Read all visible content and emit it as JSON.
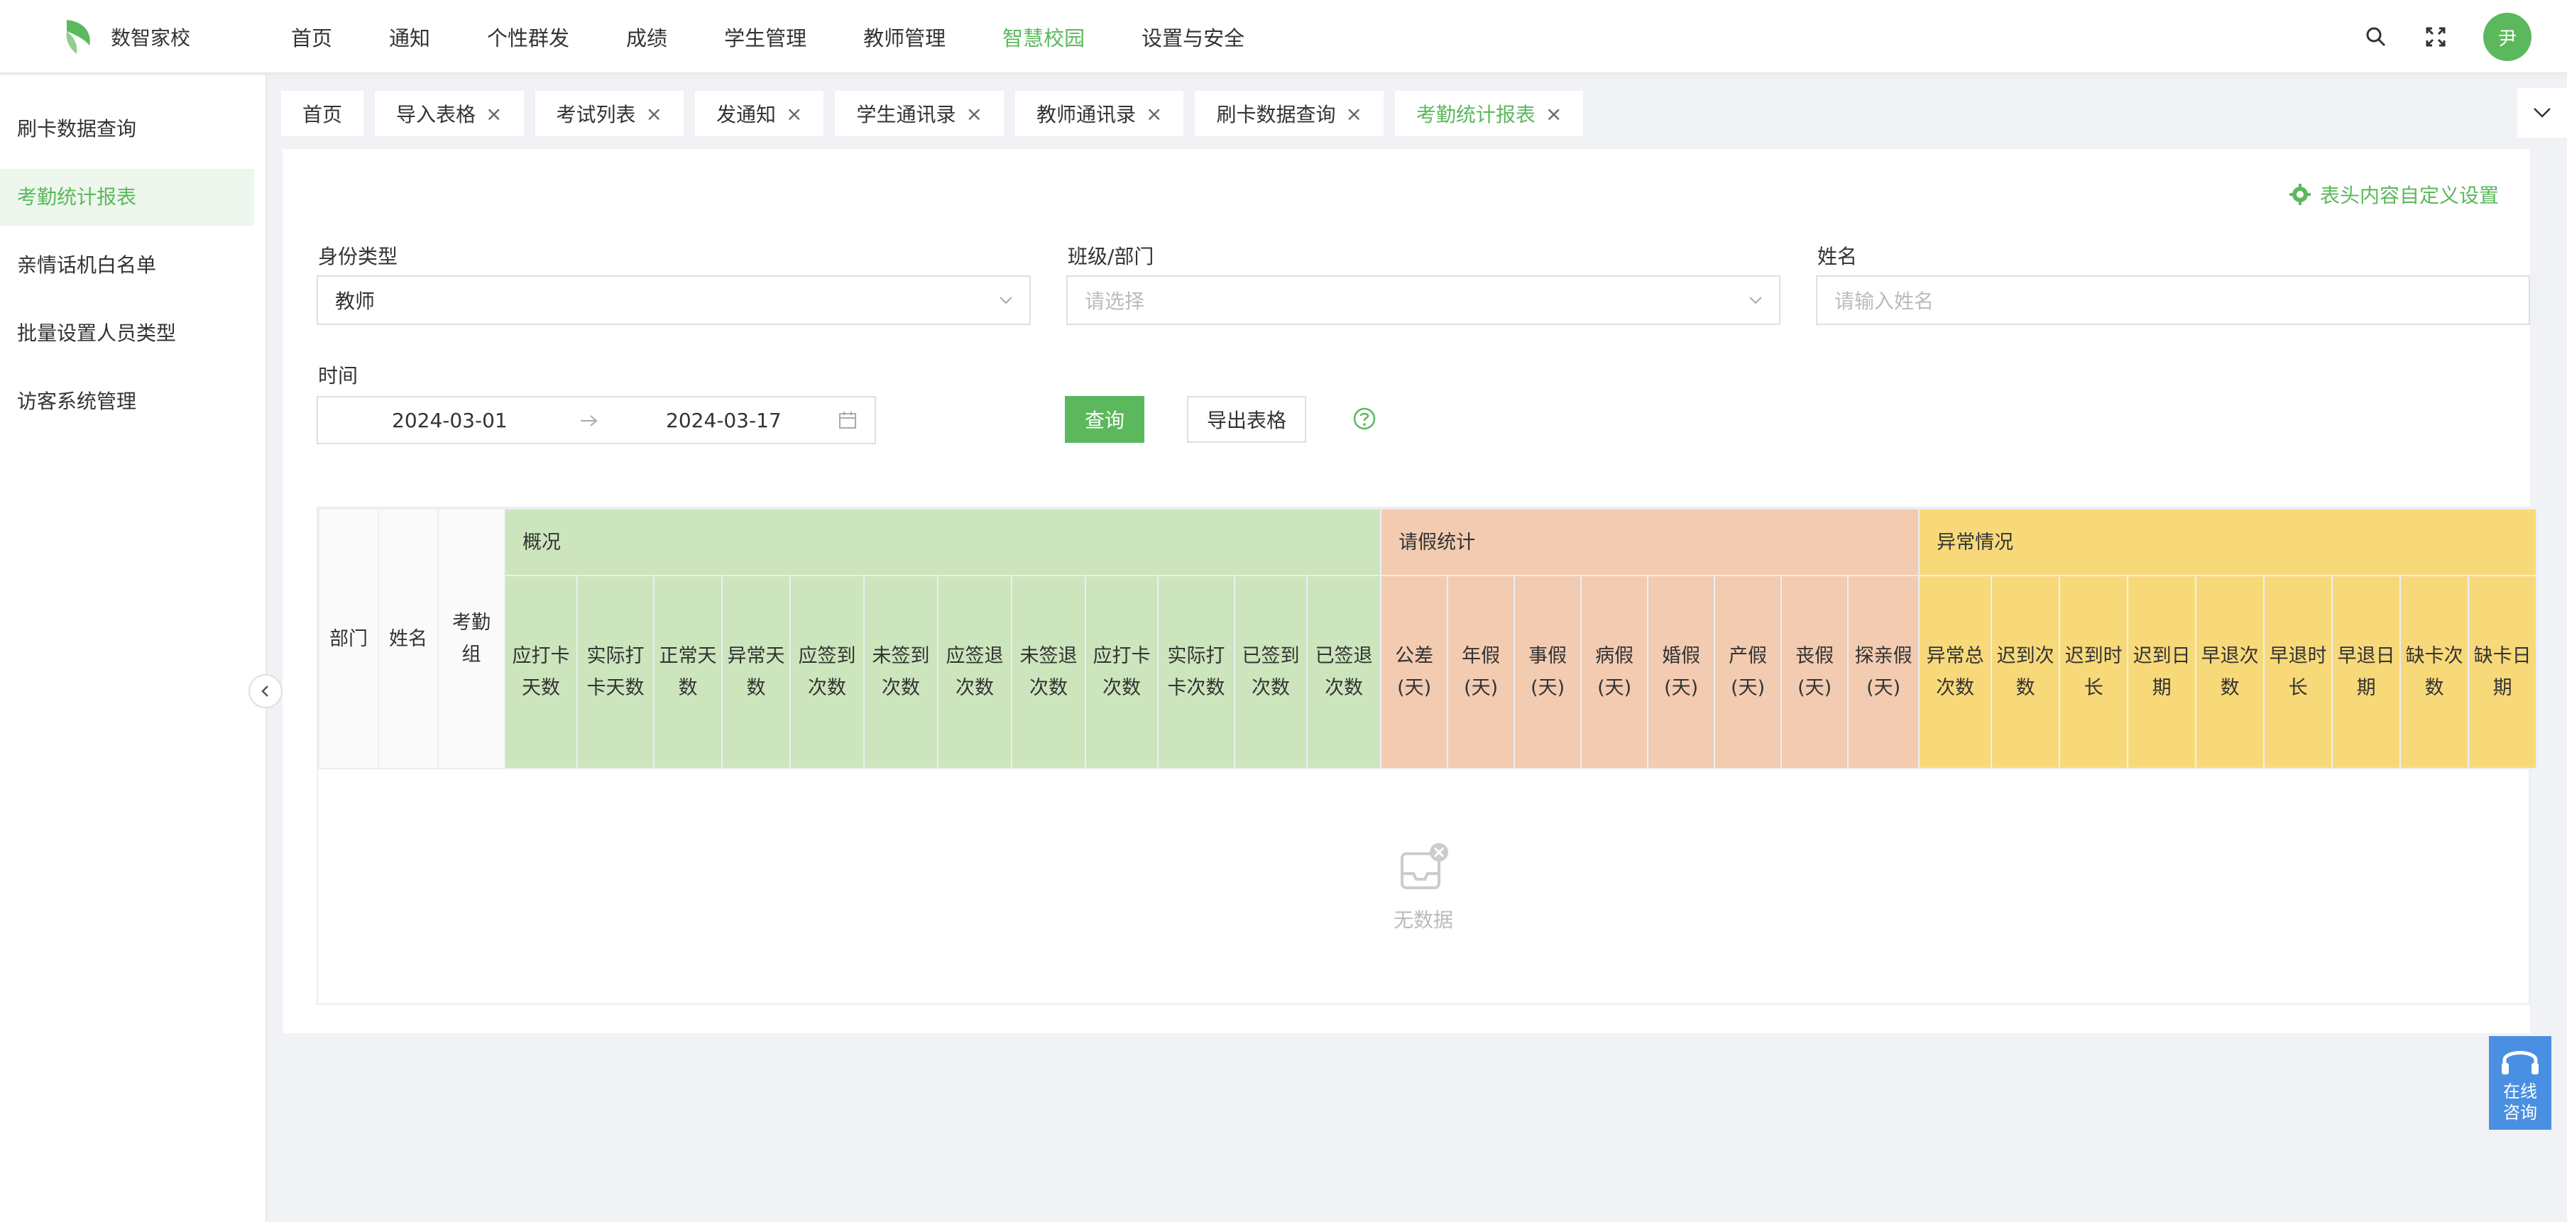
{
  "app": {
    "name": "数智家校",
    "avatar_text": "尹"
  },
  "nav": {
    "items": [
      {
        "label": "首页"
      },
      {
        "label": "通知"
      },
      {
        "label": "个性群发"
      },
      {
        "label": "成绩"
      },
      {
        "label": "学生管理"
      },
      {
        "label": "教师管理"
      },
      {
        "label": "智慧校园"
      },
      {
        "label": "设置与安全"
      }
    ],
    "active": "智慧校园"
  },
  "sidebar": {
    "items": [
      {
        "label": "刷卡数据查询"
      },
      {
        "label": "考勤统计报表"
      },
      {
        "label": "亲情话机白名单"
      },
      {
        "label": "批量设置人员类型"
      },
      {
        "label": "访客系统管理"
      }
    ],
    "active": "考勤统计报表"
  },
  "tabs": [
    {
      "label": "首页"
    },
    {
      "label": "导入表格"
    },
    {
      "label": "考试列表"
    },
    {
      "label": "发通知"
    },
    {
      "label": "学生通讯录"
    },
    {
      "label": "教师通讯录"
    },
    {
      "label": "刷卡数据查询"
    },
    {
      "label": "考勤统计报表"
    }
  ],
  "tab_close": "×",
  "filters": {
    "custom_setting": "表头内容自定义设置",
    "identity": {
      "label": "身份类型",
      "value": "教师"
    },
    "class": {
      "label": "班级/部门",
      "placeholder": "请选择"
    },
    "name": {
      "label": "姓名",
      "placeholder": "请输入姓名"
    },
    "time": {
      "label": "时间",
      "start": "2024-03-01",
      "end": "2024-03-17"
    },
    "query_button": "查询",
    "export_button": "导出表格"
  },
  "table": {
    "base_columns": [
      "部门",
      "姓名",
      "考勤组"
    ],
    "groups": [
      {
        "title": "概况",
        "color": "#cce5bc",
        "columns": [
          "应打卡天数",
          "实际打卡天数",
          "正常天数",
          "异常天数",
          "应签到次数",
          "未签到次数",
          "应签退次数",
          "未签退次数",
          "应打卡次数",
          "实际打卡次数",
          "已签到次数",
          "已签退次数"
        ]
      },
      {
        "title": "请假统计",
        "color": "#f2cbb1",
        "columns": [
          "公差(天)",
          "年假(天)",
          "事假(天)",
          "病假(天)",
          "婚假(天)",
          "产假(天)",
          "丧假(天)",
          "探亲假(天)"
        ]
      },
      {
        "title": "异常情况",
        "color": "#f8d97a",
        "columns": [
          "异常总次数",
          "迟到次数",
          "迟到时长",
          "迟到日期",
          "早退次数",
          "早退时长",
          "早退日期",
          "缺卡次数",
          "缺卡日期"
        ]
      }
    ],
    "empty_text": "无数据"
  },
  "consult": {
    "line1": "在线",
    "line2": "咨询"
  }
}
